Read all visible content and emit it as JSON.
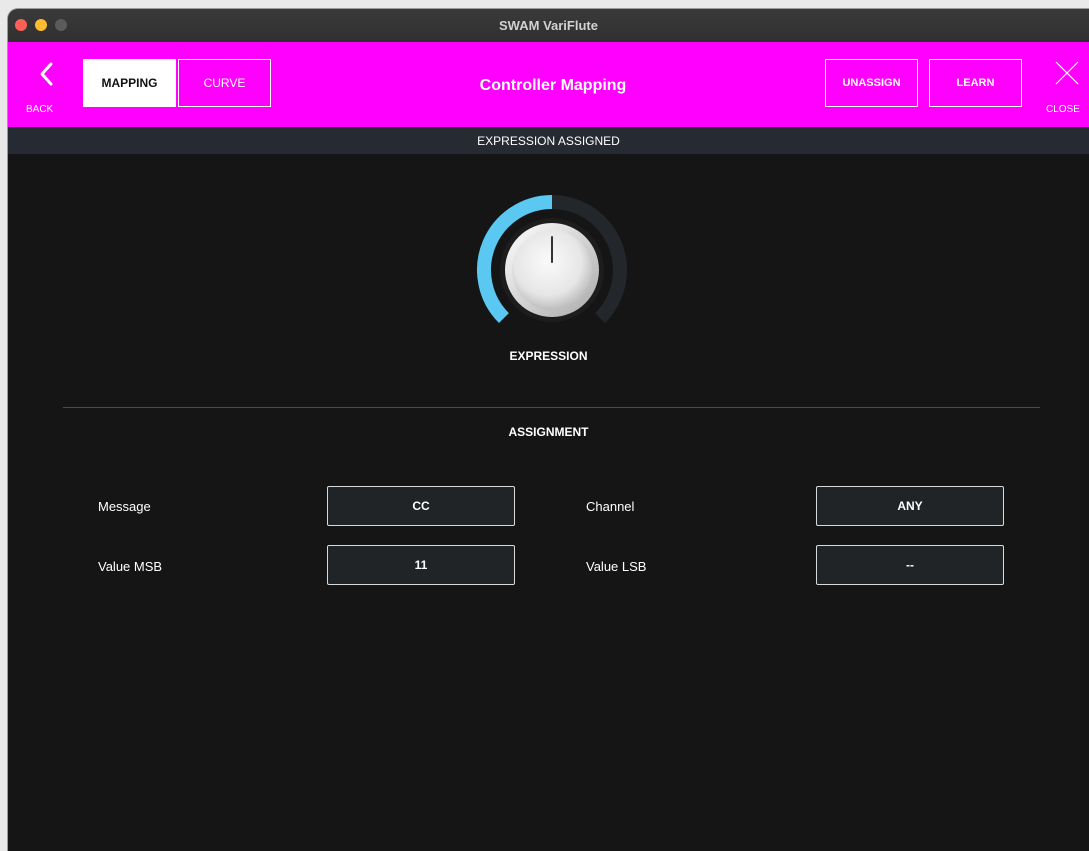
{
  "window": {
    "title": "SWAM VariFlute"
  },
  "toolbar": {
    "back_label": "BACK",
    "tabs": [
      {
        "label": "MAPPING",
        "active": true
      },
      {
        "label": "CURVE",
        "active": false
      }
    ],
    "title": "Controller Mapping",
    "unassign_label": "UNASSIGN",
    "learn_label": "LEARN",
    "close_label": "CLOSE",
    "accent_color": "#ff00fe"
  },
  "status": {
    "text": "EXPRESSION ASSIGNED"
  },
  "knob": {
    "label": "EXPRESSION",
    "value_fraction": 0.5,
    "arc_color": "#5bc8f2",
    "track_color": "#23272b"
  },
  "assignment": {
    "title": "ASSIGNMENT",
    "message_label": "Message",
    "message_value": "CC",
    "channel_label": "Channel",
    "channel_value": "ANY",
    "msb_label": "Value MSB",
    "msb_value": "11",
    "lsb_label": "Value LSB",
    "lsb_value": "--"
  }
}
